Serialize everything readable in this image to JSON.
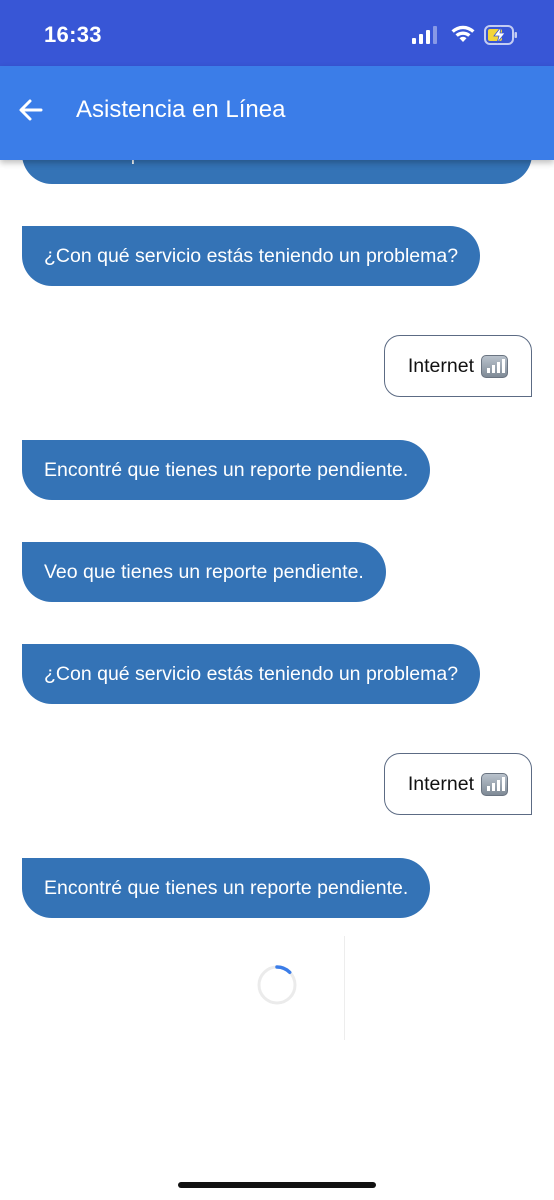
{
  "status_bar": {
    "time": "16:33",
    "icons": [
      "signal-icon",
      "wifi-icon",
      "battery-charging-icon"
    ]
  },
  "app_bar": {
    "title": "Asistencia en Línea",
    "back_icon": "arrow-left-icon"
  },
  "messages": [
    {
      "from": "bot",
      "text": "momento por favor."
    },
    {
      "from": "bot",
      "text": "¿Con qué servicio estás teniendo un problema?"
    },
    {
      "from": "user",
      "text": "Internet",
      "emoji": "signal-bars-emoji"
    },
    {
      "from": "bot",
      "text": "Encontré que tienes un reporte pendiente."
    },
    {
      "from": "bot",
      "text": "Veo que tienes un reporte pendiente."
    },
    {
      "from": "bot",
      "text": "¿Con qué servicio estás teniendo un problema?"
    },
    {
      "from": "user",
      "text": "Internet",
      "emoji": "signal-bars-emoji"
    },
    {
      "from": "bot",
      "text": "Encontré que tienes un reporte pendiente."
    }
  ],
  "colors": {
    "status_bar": "#3856d6",
    "app_bar": "#3b7de8",
    "bot_bubble": "#3473b6",
    "user_border": "#5c6b84",
    "spinner": "#3b7de8"
  }
}
